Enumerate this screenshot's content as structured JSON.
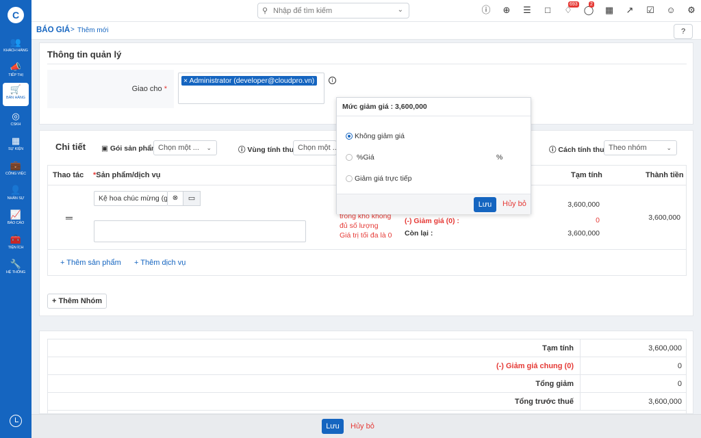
{
  "sidebar": {
    "logo": "C",
    "items": [
      {
        "label": "Khách hàng",
        "icon": "customers-icon",
        "glyph": "👥"
      },
      {
        "label": "Tiếp thị",
        "icon": "megaphone-icon",
        "glyph": "📣"
      },
      {
        "label": "Bán hàng",
        "icon": "cart-icon",
        "glyph": "🛒"
      },
      {
        "label": "CSKH",
        "icon": "support-icon",
        "glyph": "◎"
      },
      {
        "label": "Sự kiện",
        "icon": "calendar-icon",
        "glyph": "▦"
      },
      {
        "label": "Công việc",
        "icon": "briefcase-icon",
        "glyph": "💼"
      },
      {
        "label": "Nhân sự",
        "icon": "person-icon",
        "glyph": "👤"
      },
      {
        "label": "Báo cáo",
        "icon": "report-icon",
        "glyph": "📈"
      },
      {
        "label": "Tiện ích",
        "icon": "tools-box-icon",
        "glyph": "🧰"
      },
      {
        "label": "Hệ thống",
        "icon": "wrench-icon",
        "glyph": "🔧"
      }
    ],
    "active_index": 2
  },
  "topbar": {
    "search_placeholder": "Nhập để tìm kiếm",
    "notifications_count": "693",
    "messages_count": "2"
  },
  "breadcrumb": {
    "module": "BÁO GIÁ",
    "separator": ">",
    "page": "Thêm mới",
    "help_glyph": "?"
  },
  "management": {
    "title": "Thông tin quản lý",
    "assign_label": "Giao cho",
    "required_mark": "*",
    "assignee": "× Administrator (developer@cloudpro.vn)",
    "info_glyph": "i"
  },
  "details": {
    "title": "Chi tiết",
    "package_label": "Gói sản phẩm",
    "package_value": "Chọn một ...",
    "tax_region_label": "Vùng tính thuế",
    "tax_region_value": "Chọn một ...",
    "tax_method_label": "Cách tính thuế",
    "tax_method_value": "Theo nhóm",
    "columns": {
      "actions": "Thao tác",
      "product": "Sản phẩm/dịch vụ",
      "subtotal": "Tạm tính",
      "total": "Thành tiền"
    },
    "row": {
      "product_value": "Kệ hoa chúc mừng (gỗ)",
      "warning_lines": [
        "trong kho không",
        "đủ số lượng",
        "Giá trị tối đa là 0"
      ],
      "discount_label": "(-) Giảm giá (0) :",
      "remaining_label": "Còn lại :",
      "subtotal": "3,600,000",
      "discount": "0",
      "remaining": "3,600,000",
      "total": "3,600,000"
    },
    "add_product": "Thêm sản phẩm",
    "add_service": "Thêm dịch vụ",
    "add_group": "Thêm Nhóm"
  },
  "summary": {
    "rows": [
      {
        "label": "Tạm tính",
        "value": "3,600,000",
        "red": false
      },
      {
        "label": "(-) Giảm giá chung (0)",
        "value": "0",
        "red": true
      },
      {
        "label": "Tổng giảm",
        "value": "0",
        "red": false
      },
      {
        "label": "Tổng trước thuế",
        "value": "3,600,000",
        "red": false
      }
    ]
  },
  "discount_popover": {
    "title": "Mức giảm giá : 3,600,000",
    "options": [
      {
        "label": "Không giảm giá",
        "checked": true
      },
      {
        "label": "%Giá",
        "checked": false
      },
      {
        "label": "Giảm giá trực tiếp",
        "checked": false
      }
    ],
    "percent_suffix": "%",
    "save": "Lưu",
    "cancel": "Hủy bỏ"
  },
  "footer": {
    "save": "Lưu",
    "cancel": "Hủy bỏ"
  },
  "colors": {
    "primary": "#1565c0",
    "danger": "#e53935",
    "background": "#eef1f5"
  }
}
